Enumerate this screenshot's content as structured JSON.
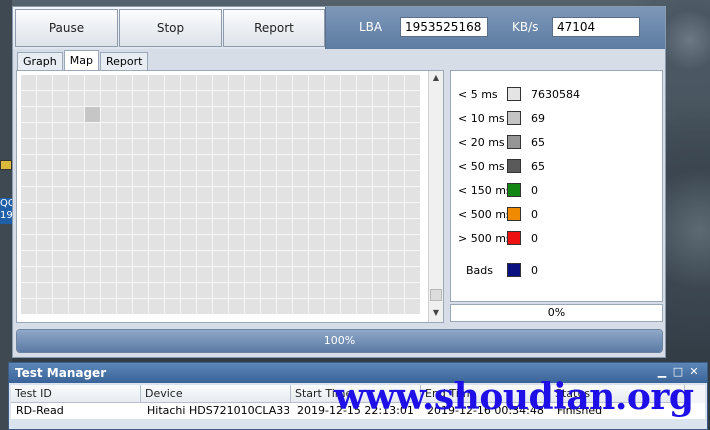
{
  "toolbar": {
    "pause_label": "Pause",
    "stop_label": "Stop",
    "report_label": "Report",
    "lba_label": "LBA",
    "lba_value": "1953525168",
    "kbs_label": "KB/s",
    "kbs_value": "47104"
  },
  "tabs": [
    {
      "label": "Graph",
      "active": false
    },
    {
      "label": "Map",
      "active": true
    },
    {
      "label": "Report",
      "active": false
    }
  ],
  "legend": [
    {
      "label": "< 5 ms",
      "value": "7630584",
      "color": "#e4e4e4"
    },
    {
      "label": "< 10 ms",
      "value": "69",
      "color": "#c4c4c4"
    },
    {
      "label": "< 20 ms",
      "value": "65",
      "color": "#969696"
    },
    {
      "label": "< 50 ms",
      "value": "65",
      "color": "#5a5a5a"
    },
    {
      "label": "< 150 ms",
      "value": "0",
      "color": "#138613"
    },
    {
      "label": "< 500 ms",
      "value": "0",
      "color": "#f08a00"
    },
    {
      "label": "> 500 ms",
      "value": "0",
      "color": "#ee1111"
    },
    {
      "label": "Bads",
      "value": "0",
      "color": "#0a1080"
    }
  ],
  "map_percent": "0%",
  "progress": {
    "label": "100%",
    "fraction": 1.0
  },
  "test_manager": {
    "title": "Test Manager",
    "columns": [
      "Test ID",
      "Device",
      "Start Time",
      "End Time",
      "Status"
    ],
    "row": [
      "RD-Read",
      "Hitachi HDS721010CLA33...",
      "2019-12-15 22:13:01",
      "2019-12-16 00:34:48",
      "Finished"
    ]
  },
  "desktop": {
    "label": "QQ 19"
  },
  "watermark": "www.shoudian.org"
}
